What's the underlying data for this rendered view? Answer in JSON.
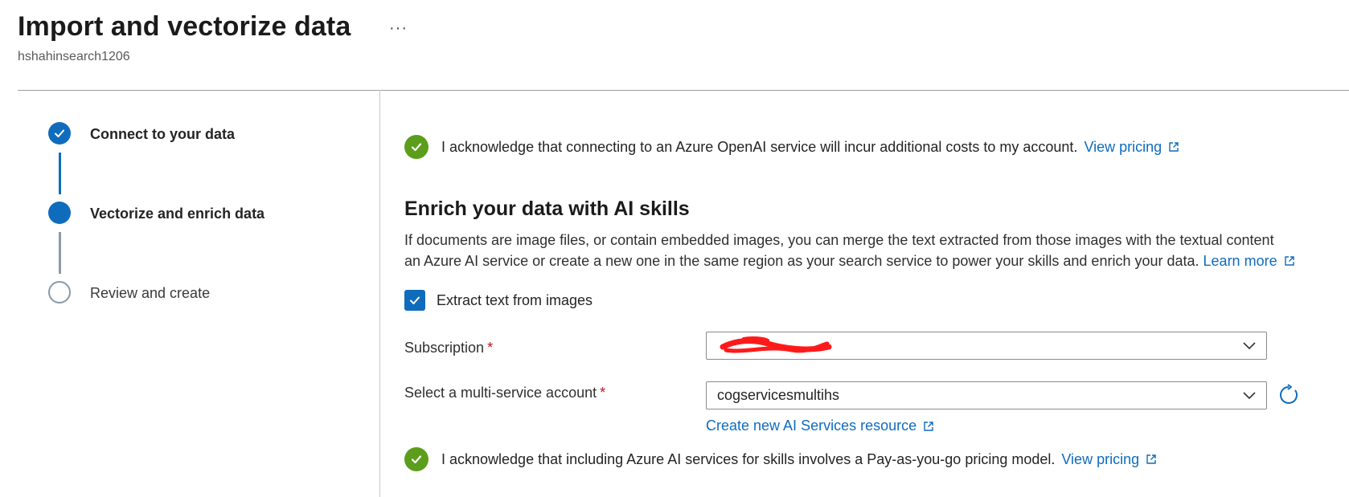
{
  "header": {
    "title": "Import and vectorize data",
    "more": "···",
    "subtitle": "hshahinsearch1206"
  },
  "steps": [
    {
      "label": "Connect to your data",
      "state": "done"
    },
    {
      "label": "Vectorize and enrich data",
      "state": "current"
    },
    {
      "label": "Review and create",
      "state": "pending"
    }
  ],
  "openai_ack": {
    "text": "I acknowledge that connecting to an Azure OpenAI service will incur additional costs to my account.",
    "link": "View pricing"
  },
  "enrich": {
    "heading": "Enrich your data with AI skills",
    "desc_line1": "If documents are image files, or contain embedded images, you can merge the text extracted from those images with the textual content",
    "desc_line2": "an Azure AI service or create a new one in the same region as your search service to power your skills and enrich your data.",
    "learn_more": "Learn more"
  },
  "extract_checkbox": {
    "label": "Extract text from images",
    "checked": true
  },
  "subscription": {
    "label": "Subscription",
    "required_mark": "*",
    "value": "",
    "redacted": true
  },
  "account": {
    "label": "Select a multi-service account",
    "required_mark": "*",
    "value": "cogservicesmultihs"
  },
  "create_link": "Create new AI Services resource",
  "ai_ack": {
    "text": "I acknowledge that including Azure AI services for skills involves a Pay-as-you-go pricing model.",
    "link": "View pricing"
  },
  "colors": {
    "accent": "#0f6cbd",
    "success": "#5c9e1b",
    "required": "#c50f1f"
  },
  "icons": [
    "more-icon",
    "checkmark-icon",
    "external-link-icon",
    "chevron-down-icon",
    "refresh-icon"
  ]
}
